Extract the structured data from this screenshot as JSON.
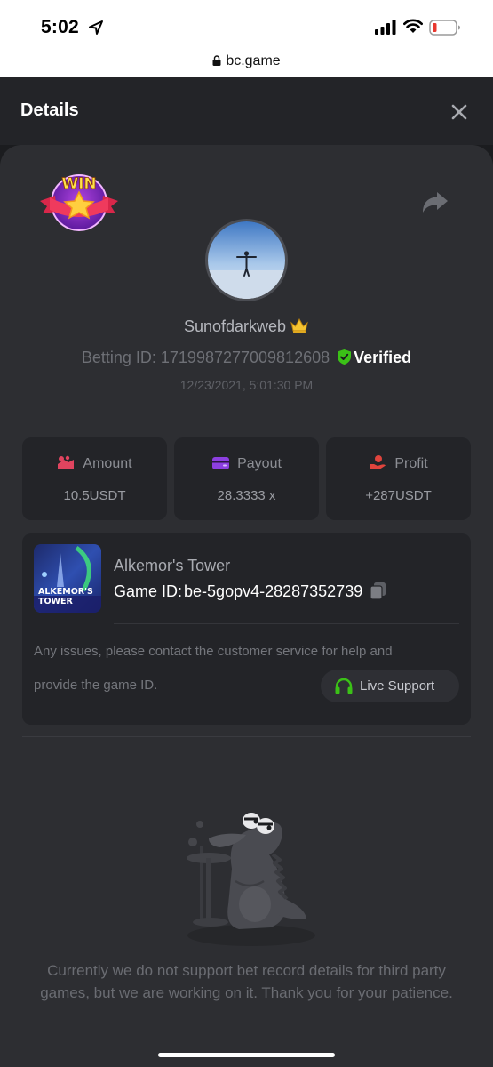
{
  "status_bar": {
    "time": "5:02",
    "icons": [
      "location-arrow-icon",
      "signal-icon",
      "wifi-icon",
      "battery-icon"
    ]
  },
  "url_bar": {
    "url": "bc.game",
    "icon": "lock-icon"
  },
  "header": {
    "title": "Details",
    "close_icon": "close-icon"
  },
  "bet": {
    "badge_text": "WIN",
    "username": "Sunofdarkweb",
    "betting_id_label": "Betting ID: 1719987277009812608",
    "verified_label": "Verified",
    "timestamp": "12/23/2021, 5:01:30 PM"
  },
  "stats": {
    "amount": {
      "label": "Amount",
      "value": "10.5USDT",
      "icon": "coins-icon"
    },
    "payout": {
      "label": "Payout",
      "value": "28.3333 x",
      "icon": "wallet-icon"
    },
    "profit": {
      "label": "Profit",
      "value": "+287USDT",
      "icon": "hand-coin-icon"
    }
  },
  "game": {
    "thumb_text_1": "ALKEMOR'S",
    "thumb_text_2": "TOWER",
    "name": "Alkemor's Tower",
    "game_id_label": "Game ID:",
    "game_id": "be-5gopv4-28287352739",
    "help_line1": "Any issues, please contact the customer service for help and",
    "help_line2": "provide the game ID.",
    "support_label": "Live Support"
  },
  "notice": "Currently we do not support bet record details for third party games, but we are working on it. Thank you for your patience.",
  "colors": {
    "background": "#1b1c1f",
    "card": "#2d2e32",
    "panel": "#232428",
    "verified_green": "#3bc117",
    "amount_icon": "#e0445f",
    "payout_icon": "#8c3fe0",
    "profit_icon": "#e0443d",
    "support_icon": "#3bc117"
  }
}
